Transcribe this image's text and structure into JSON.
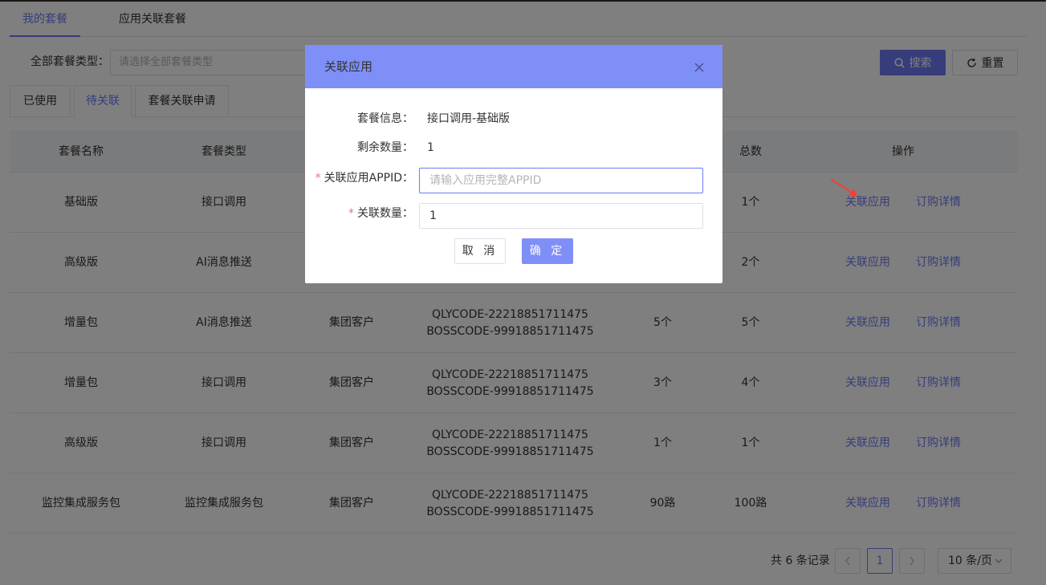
{
  "top_tabs": [
    {
      "label": "我的套餐",
      "active": true
    },
    {
      "label": "应用关联套餐",
      "active": false
    }
  ],
  "filter": {
    "label": "全部套餐类型：",
    "placeholder": "请选择全部套餐类型"
  },
  "buttons": {
    "search": "搜索",
    "reset": "重置"
  },
  "sub_tabs": [
    {
      "label": "已使用",
      "active": false
    },
    {
      "label": "待关联",
      "active": true
    },
    {
      "label": "套餐关联申请",
      "active": false
    }
  ],
  "table": {
    "headers": [
      "套餐名称",
      "套餐类型",
      "",
      "",
      "",
      "总数",
      "操作"
    ],
    "rows": [
      {
        "name": "基础版",
        "type": "接口调用",
        "customer": "",
        "code1": "",
        "code2": "",
        "remaining": "",
        "total": "1个"
      },
      {
        "name": "高级版",
        "type": "AI消息推送",
        "customer": "",
        "code1": "",
        "code2": "",
        "remaining": "",
        "total": "2个"
      },
      {
        "name": "增量包",
        "type": "AI消息推送",
        "customer": "集团客户",
        "code1": "QLYCODE-22218851711475",
        "code2": "BOSSCODE-99918851711475",
        "remaining": "5个",
        "total": "5个"
      },
      {
        "name": "增量包",
        "type": "接口调用",
        "customer": "集团客户",
        "code1": "QLYCODE-22218851711475",
        "code2": "BOSSCODE-99918851711475",
        "remaining": "3个",
        "total": "4个"
      },
      {
        "name": "高级版",
        "type": "接口调用",
        "customer": "集团客户",
        "code1": "QLYCODE-22218851711475",
        "code2": "BOSSCODE-99918851711475",
        "remaining": "1个",
        "total": "1个"
      },
      {
        "name": "监控集成服务包",
        "type": "监控集成服务包",
        "customer": "集团客户",
        "code1": "QLYCODE-22218851711475",
        "code2": "BOSSCODE-99918851711475",
        "remaining": "90路",
        "total": "100路"
      }
    ],
    "actions": {
      "link_app": "关联应用",
      "order_detail": "订购详情"
    }
  },
  "pagination": {
    "total_text": "共 6 条记录",
    "current_page": "1",
    "page_size": "10 条/页"
  },
  "modal": {
    "title": "关联应用",
    "package_info_label": "套餐信息：",
    "package_info_value": "接口调用-基础版",
    "remaining_label": "剩余数量：",
    "remaining_value": "1",
    "appid_label": "关联应用APPID：",
    "appid_placeholder": "请输入应用完整APPID",
    "quantity_label": "关联数量：",
    "quantity_value": "1",
    "cancel": "取 消",
    "confirm": "确 定"
  },
  "colors": {
    "accent": "#6c7bf5",
    "modal_header": "#7f8ff8",
    "required": "#f56c6c",
    "arrow": "#ff3b30"
  },
  "icons": {
    "search": "search-icon",
    "reset": "refresh-icon",
    "close": "close-icon",
    "prev": "chevron-left-icon",
    "next": "chevron-right-icon",
    "size": "chevron-down-icon",
    "pointer": "red-arrow-icon"
  }
}
